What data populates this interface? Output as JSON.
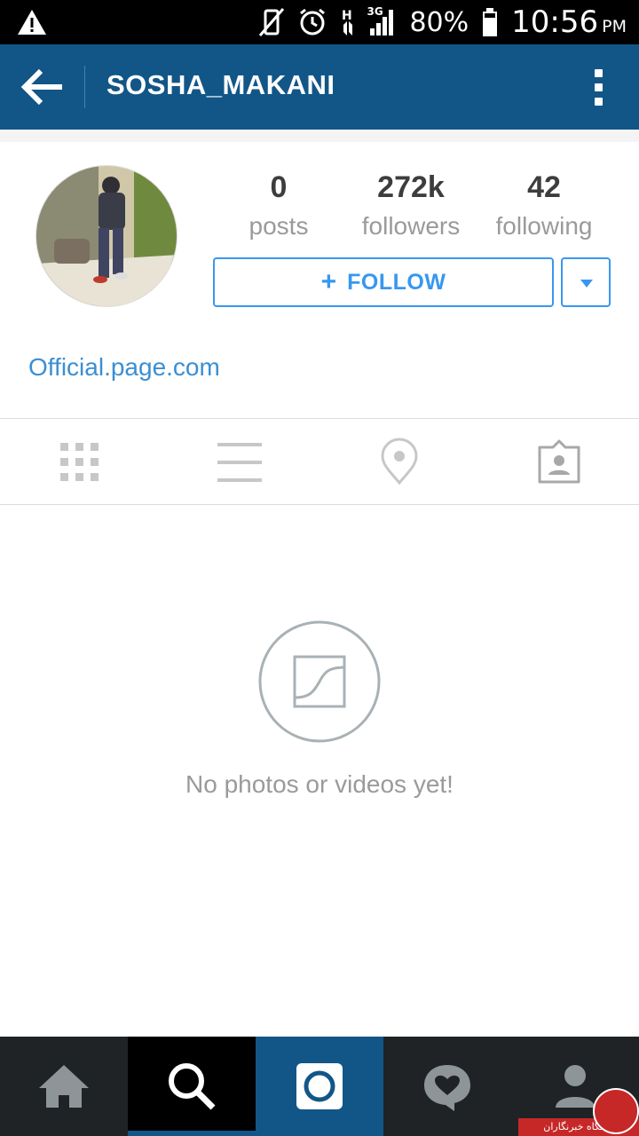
{
  "status_bar": {
    "battery": "80%",
    "time": "10:56",
    "ampm": "PM",
    "network": "3G"
  },
  "header": {
    "title": "SOSHA_MAKANI"
  },
  "profile": {
    "stats": [
      {
        "value": "0",
        "label": "posts"
      },
      {
        "value": "272k",
        "label": "followers"
      },
      {
        "value": "42",
        "label": "following"
      }
    ],
    "follow_label": "FOLLOW",
    "website": "Official.page.com"
  },
  "tabs": [
    "grid-icon",
    "list-icon",
    "location-pin-icon",
    "tagged-photos-icon"
  ],
  "empty_state": {
    "text": "No photos or videos yet!"
  },
  "bottom_nav": [
    "home-icon",
    "search-icon",
    "camera-icon",
    "activity-heart-icon",
    "profile-icon"
  ],
  "watermark": {
    "text": "باشگاه خبرنگاران"
  },
  "colors": {
    "header_bg": "#125688",
    "accent_blue": "#3897f0",
    "link": "#3b8fd3",
    "nav_bg": "#1f2326"
  }
}
